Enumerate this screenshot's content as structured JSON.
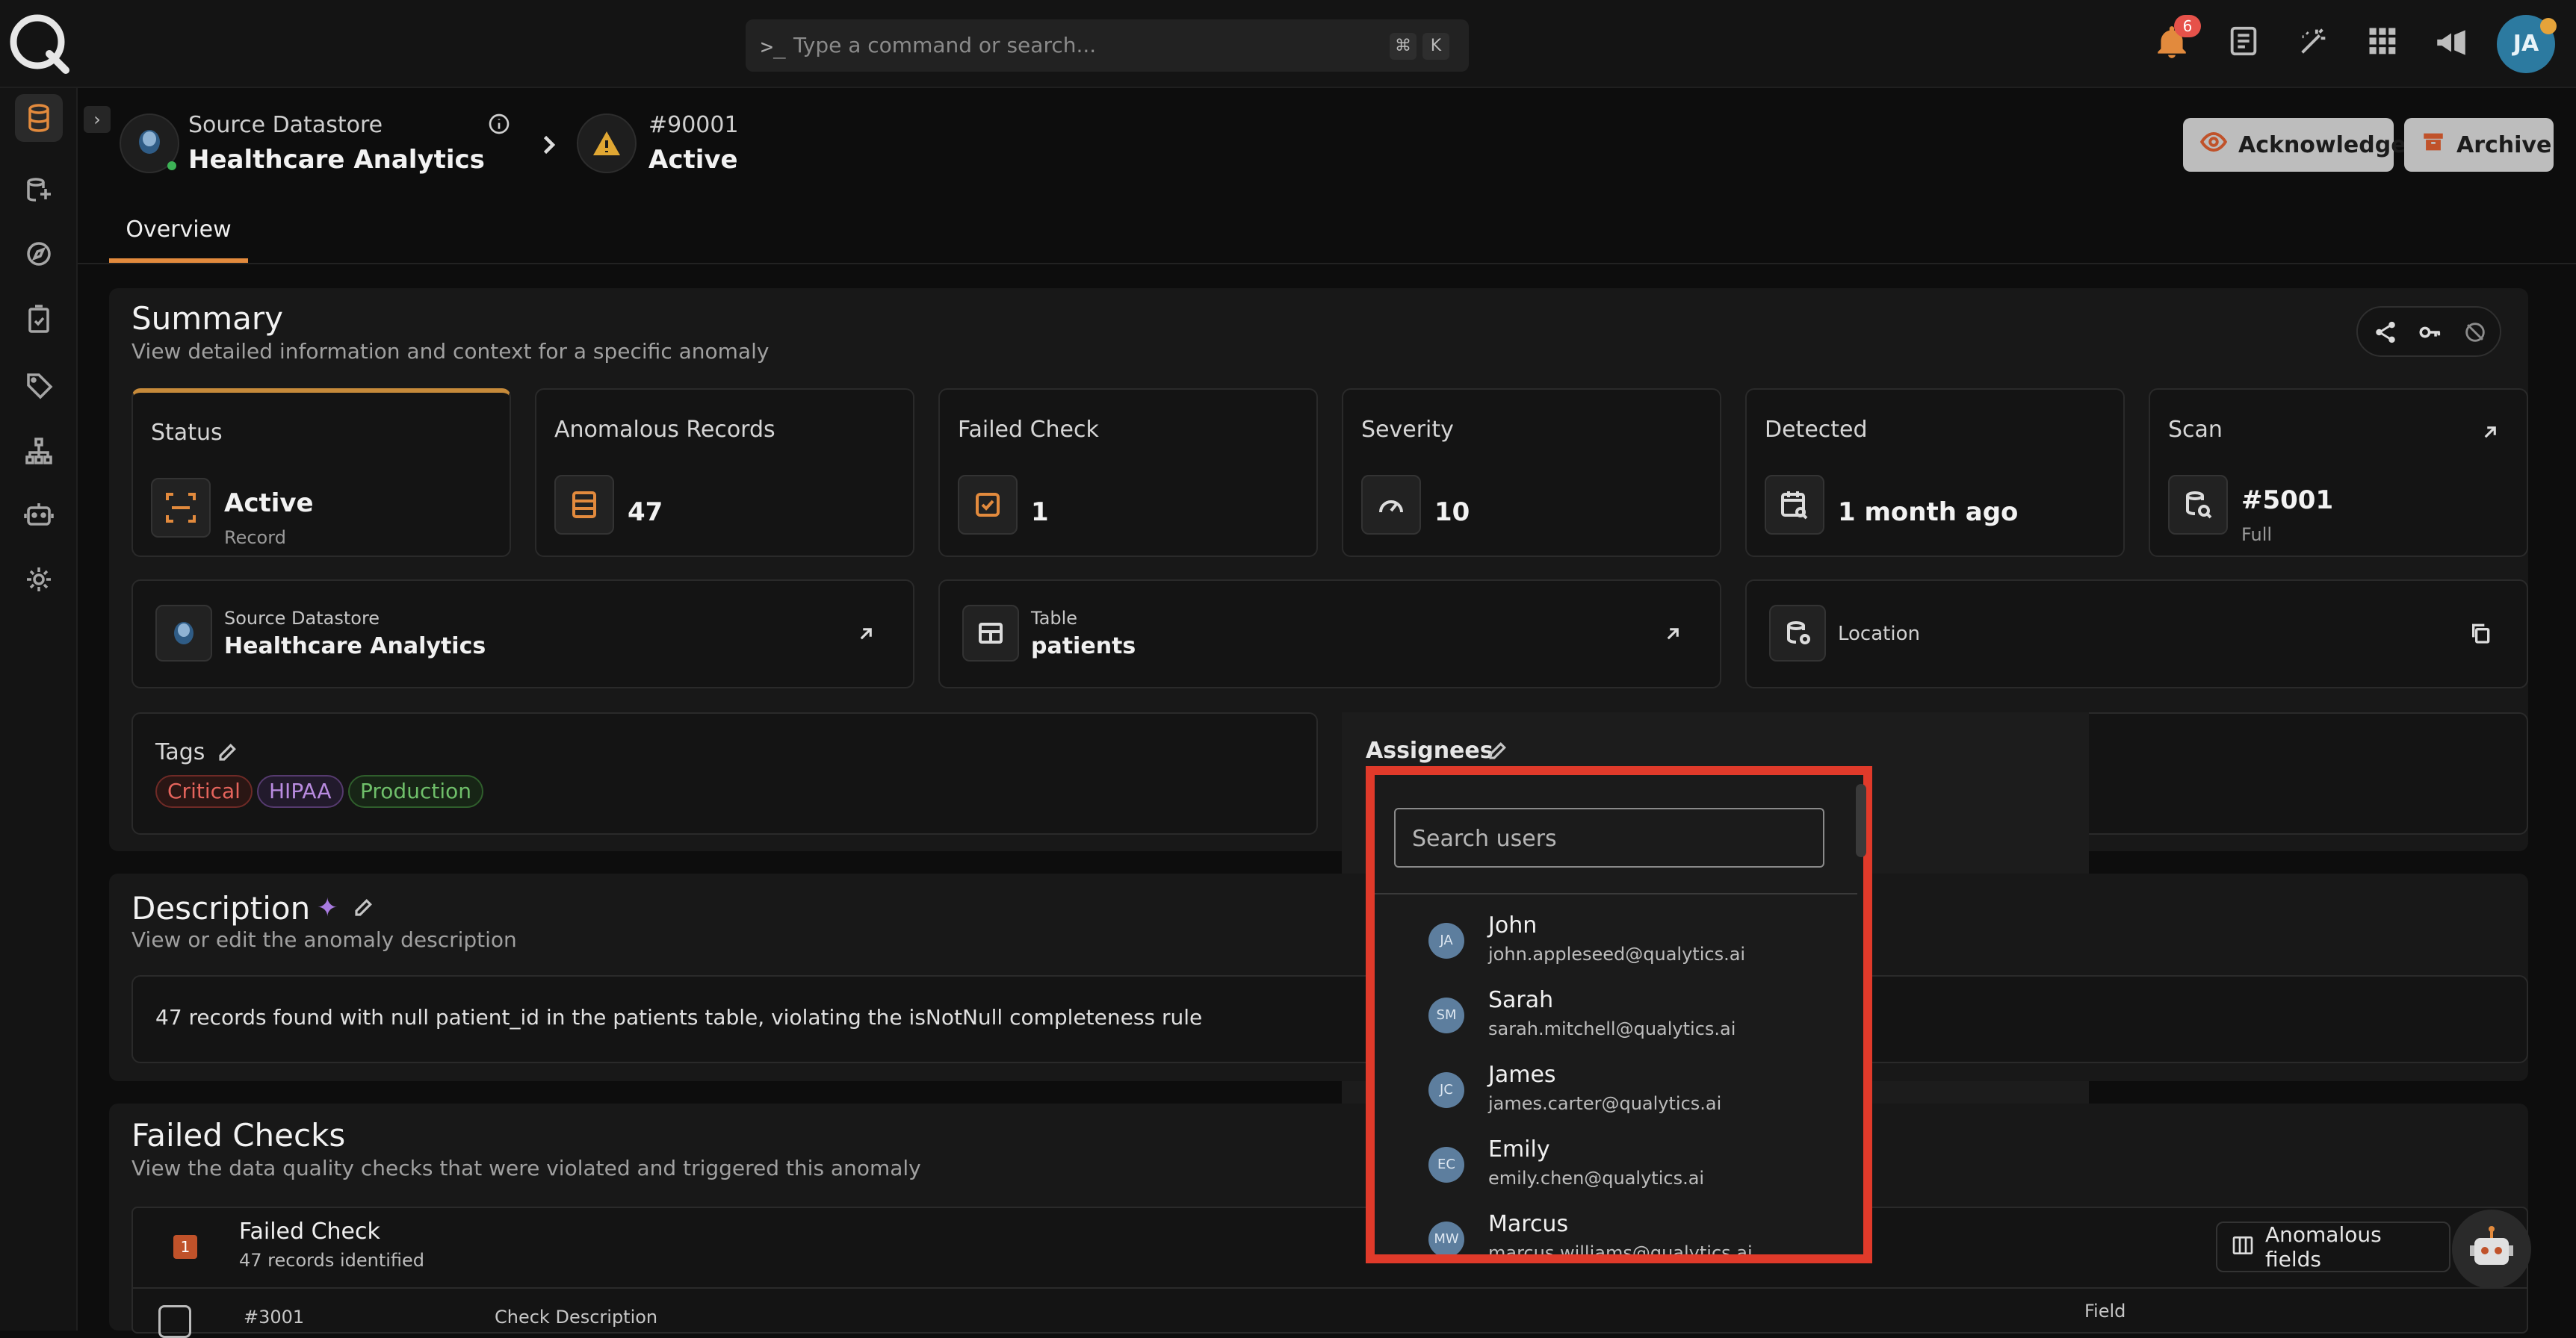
{
  "topbar": {
    "command_placeholder": "Type a command or search...",
    "shortcut_keys": [
      "⌘",
      "K"
    ],
    "notification_count": "6",
    "user_initials": "JA"
  },
  "breadcrumb": {
    "datastore_label": "Source Datastore",
    "datastore_name": "Healthcare Analytics",
    "anomaly_id": "#90001",
    "anomaly_status": "Active"
  },
  "actions": {
    "acknowledge_label": "Acknowledge",
    "archive_label": "Archive"
  },
  "tabs": {
    "overview": "Overview"
  },
  "summary": {
    "title": "Summary",
    "subtitle": "View detailed information and context for a specific anomaly",
    "cards": {
      "status": {
        "label": "Status",
        "value": "Active",
        "sub": "Record"
      },
      "anomalous_records": {
        "label": "Anomalous Records",
        "value": "47"
      },
      "failed_check": {
        "label": "Failed Check",
        "value": "1"
      },
      "severity": {
        "label": "Severity",
        "value": "10"
      },
      "detected": {
        "label": "Detected",
        "value": "1 month ago"
      },
      "scan": {
        "label": "Scan",
        "value": "#5001",
        "sub": "Full"
      }
    },
    "datastore": {
      "label": "Source Datastore",
      "value": "Healthcare Analytics"
    },
    "table": {
      "label": "Table",
      "value": "patients"
    },
    "location": {
      "label": "Location"
    },
    "tags": {
      "label": "Tags",
      "items": [
        "Critical",
        "HIPAA",
        "Production"
      ]
    },
    "assignees": {
      "label": "Assignees"
    }
  },
  "assignee_dropdown": {
    "search_placeholder": "Search users",
    "users": [
      {
        "initials": "JA",
        "name": "John",
        "email": "john.appleseed@qualytics.ai"
      },
      {
        "initials": "SM",
        "name": "Sarah",
        "email": "sarah.mitchell@qualytics.ai"
      },
      {
        "initials": "JC",
        "name": "James",
        "email": "james.carter@qualytics.ai"
      },
      {
        "initials": "EC",
        "name": "Emily",
        "email": "emily.chen@qualytics.ai"
      },
      {
        "initials": "MW",
        "name": "Marcus",
        "email": "marcus.williams@qualytics.ai"
      }
    ]
  },
  "description": {
    "title": "Description",
    "subtitle": "View or edit the anomaly description",
    "text": "47 records found with null patient_id in the patients table, violating the isNotNull completeness rule"
  },
  "failed_checks": {
    "title": "Failed Checks",
    "subtitle": "View the data quality checks that were violated and triggered this anomaly",
    "badge": "1",
    "row_title": "Failed Check",
    "row_sub": "47 records identified",
    "anomalous_fields_label": "Anomalous fields",
    "check_id": "#3001",
    "col_check_description": "Check Description",
    "col_field": "Field"
  },
  "colors": {
    "accent": "#e28a3d",
    "highlight_box": "#e03a2a",
    "tag_critical": "#e5645c",
    "tag_hipaa": "#b98be0",
    "tag_production": "#6fbf6a"
  }
}
